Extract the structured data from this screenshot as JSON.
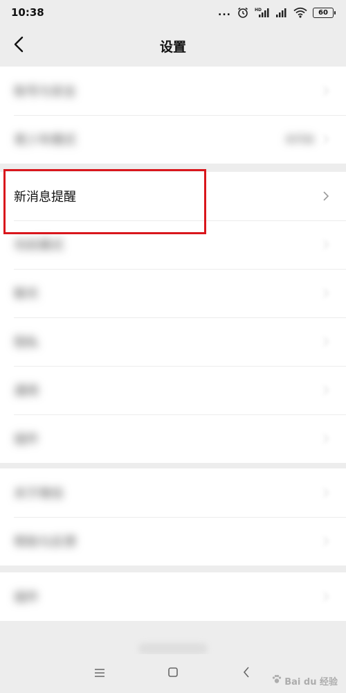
{
  "status_bar": {
    "time": "10:38",
    "dots": "...",
    "icons": [
      "alarm-icon",
      "hd-signal-icon",
      "signal-icon",
      "wifi-icon"
    ],
    "battery": "60"
  },
  "header": {
    "title": "设置",
    "back_icon": "chevron-left-icon"
  },
  "groups": [
    {
      "items": [
        {
          "label": "账号与安全",
          "value": ""
        },
        {
          "label": "青少年模式",
          "value": "未开启"
        }
      ]
    },
    {
      "items": [
        {
          "label": "新消息提醒",
          "value": ""
        },
        {
          "label": "勿扰模式",
          "value": ""
        },
        {
          "label": "聊天",
          "value": ""
        },
        {
          "label": "隐私",
          "value": ""
        },
        {
          "label": "通用",
          "value": ""
        },
        {
          "label": "插件",
          "value": ""
        }
      ]
    },
    {
      "items": [
        {
          "label": "关于微信",
          "value": ""
        },
        {
          "label": "帮助与反馈",
          "value": ""
        }
      ]
    },
    {
      "items": [
        {
          "label": "插件",
          "value": ""
        }
      ]
    }
  ],
  "highlight_color": "#d9161c",
  "nav_bar": {
    "icons": [
      "menu-icon",
      "home-square-icon",
      "back-chevron-icon"
    ]
  },
  "watermark": {
    "text": "Bai du 经验"
  }
}
